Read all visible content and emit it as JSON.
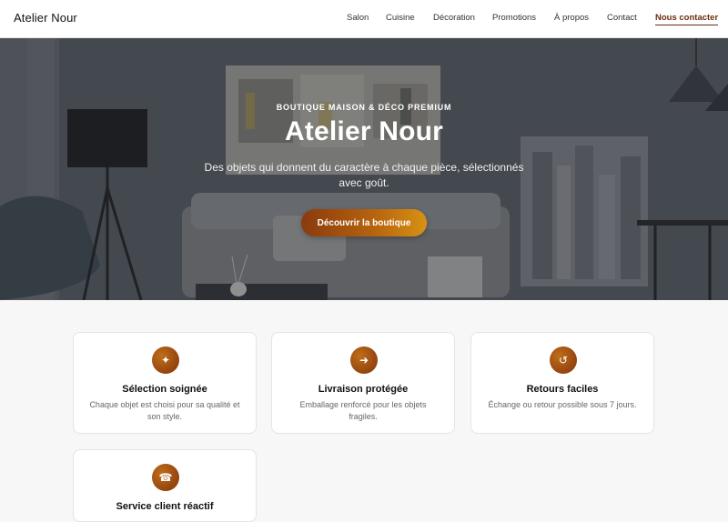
{
  "header": {
    "brand": "Atelier Nour",
    "nav": [
      {
        "label": "Salon"
      },
      {
        "label": "Cuisine"
      },
      {
        "label": "Décoration"
      },
      {
        "label": "Promotions"
      },
      {
        "label": "À propos"
      },
      {
        "label": "Contact"
      },
      {
        "label": "Nous contacter",
        "active": true
      }
    ],
    "accent_color": "#6b2d0f"
  },
  "hero": {
    "kicker": "BOUTIQUE MAISON & DÉCO PREMIUM",
    "title": "Atelier Nour",
    "subtitle": "Des objets qui donnent du caractère à chaque pièce, sélectionnés avec goût.",
    "cta_label": "Découvrir la boutique",
    "background": "living-room-photo"
  },
  "features": [
    {
      "icon": "sparkle-icon",
      "glyph": "✦",
      "title": "Sélection soignée",
      "desc": "Chaque objet est choisi pour sa qualité et son style."
    },
    {
      "icon": "arrow-right-icon",
      "glyph": "➜",
      "title": "Livraison protégée",
      "desc": "Emballage renforcé pour les objets fragiles."
    },
    {
      "icon": "refresh-icon",
      "glyph": "↺",
      "title": "Retours faciles",
      "desc": "Échange ou retour possible sous 7 jours."
    },
    {
      "icon": "phone-icon",
      "glyph": "☎",
      "title": "Service client réactif",
      "desc": ""
    }
  ]
}
